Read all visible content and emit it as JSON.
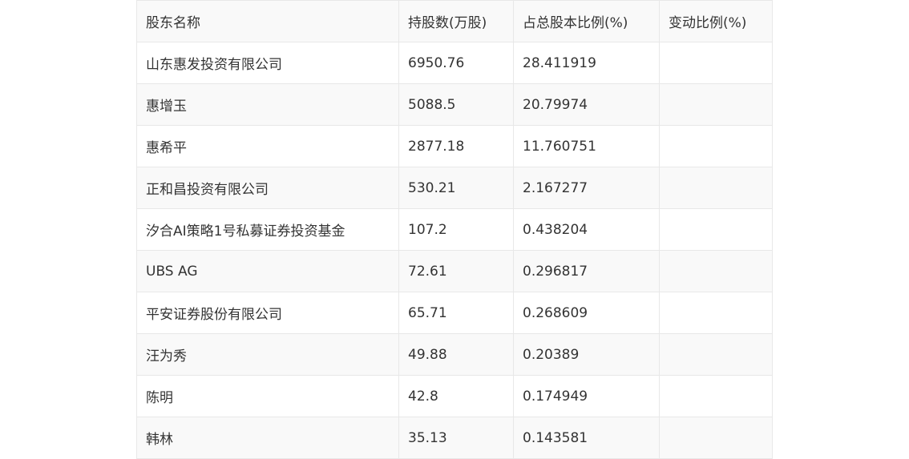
{
  "table": {
    "headers": [
      "股东名称",
      "持股数(万股)",
      "占总股本比例(%)",
      "变动比例(%)"
    ],
    "rows": [
      [
        "山东惠发投资有限公司",
        "6950.76",
        "28.411919",
        ""
      ],
      [
        "惠增玉",
        "5088.5",
        "20.79974",
        ""
      ],
      [
        "惠希平",
        "2877.18",
        "11.760751",
        ""
      ],
      [
        "正和昌投资有限公司",
        "530.21",
        "2.167277",
        ""
      ],
      [
        "汐合AI策略1号私募证券投资基金",
        "107.2",
        "0.438204",
        ""
      ],
      [
        "UBS AG",
        "72.61",
        "0.296817",
        ""
      ],
      [
        "平安证券股份有限公司",
        "65.71",
        "0.268609",
        ""
      ],
      [
        "汪为秀",
        "49.88",
        "0.20389",
        ""
      ],
      [
        "陈明",
        "42.8",
        "0.174949",
        ""
      ],
      [
        "韩林",
        "35.13",
        "0.143581",
        ""
      ]
    ]
  }
}
